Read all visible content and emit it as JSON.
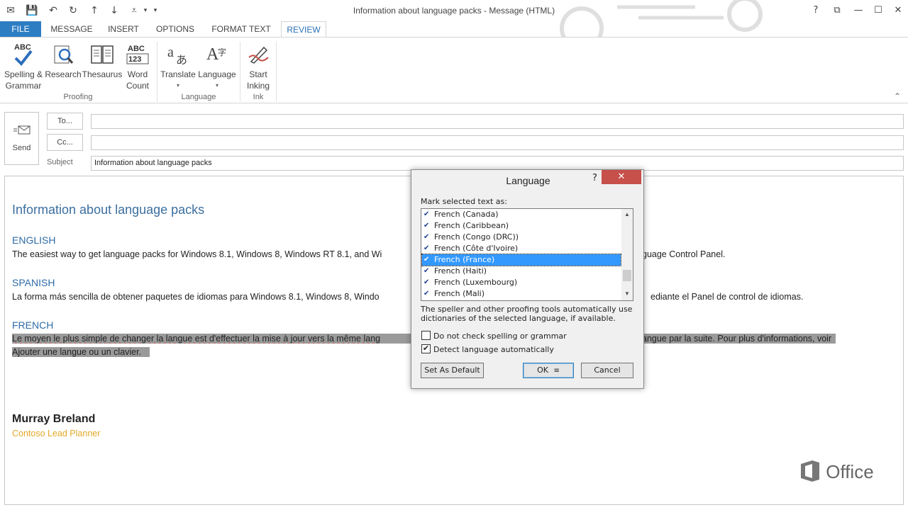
{
  "window": {
    "title": "Information about language packs - Message (HTML)",
    "help": "?",
    "restore": "⧉",
    "minimize": "—",
    "maximize": "☐",
    "close": "✕"
  },
  "qat": {
    "mail_icon": "✉",
    "save_icon": "💾",
    "undo_icon": "↶",
    "redo_icon": "↻",
    "up_icon": "↑",
    "down_icon": "↓",
    "more_icon": "▾",
    "customize_icon": "⩡"
  },
  "tabs": [
    "FILE",
    "MESSAGE",
    "INSERT",
    "OPTIONS",
    "FORMAT TEXT",
    "REVIEW"
  ],
  "ribbon": {
    "spelling_line1": "Spelling &",
    "spelling_line2": "Grammar",
    "research": "Research",
    "thesaurus": "Thesaurus",
    "word_line1": "Word",
    "word_line2": "Count",
    "translate": "Translate",
    "language": "Language",
    "start_line1": "Start",
    "start_line2": "Inking",
    "group_proofing": "Proofing",
    "group_language": "Language",
    "group_ink": "Ink",
    "abc": "ABC",
    "abc123_top": "ABC",
    "abc123_bottom": "123",
    "collapse": "⌃"
  },
  "compose": {
    "send": "Send",
    "to": "To...",
    "cc": "Cc...",
    "subject_label": "Subject",
    "to_value": "",
    "cc_value": "",
    "subject_value": "Information about language packs"
  },
  "message": {
    "title": "Information about language packs",
    "english_heading": "ENGLISH",
    "english_left": "The easiest way to get language packs for Windows 8.1, Windows 8, Windows RT 8.1, and Wi",
    "english_right": "guage Control Panel.",
    "spanish_heading": "SPANISH",
    "spanish_left": "La forma más sencilla de obtener paquetes de idiomas para Windows 8.1, Windows 8, Windo",
    "spanish_right": "ediante el Panel de control de idiomas.",
    "french_heading": "FRENCH",
    "french_left": "Le moyen le plus simple de changer la langue est d'effectuer la mise à jour vers la même lang",
    "french_right": "angue par la suite. Pour plus d'informations, voir",
    "french_line2": "Ajouter une langue ou un clavier.",
    "sig_name": "Murray Breland",
    "sig_role": "Contoso Lead Planner",
    "office": "Office"
  },
  "dialog": {
    "title": "Language",
    "help": "?",
    "close": "✕",
    "mark_label": "Mark selected text as:",
    "languages": [
      {
        "label": "French (Canada)",
        "selected": false
      },
      {
        "label": "French (Caribbean)",
        "selected": false
      },
      {
        "label": "French (Congo (DRC))",
        "selected": false
      },
      {
        "label": "French (Côte d'Ivoire)",
        "selected": false
      },
      {
        "label": "French (France)",
        "selected": true
      },
      {
        "label": "French (Haiti)",
        "selected": false
      },
      {
        "label": "French (Luxembourg)",
        "selected": false
      },
      {
        "label": "French (Mali)",
        "selected": false
      }
    ],
    "info_line1": "The speller and other proofing tools automatically use",
    "info_line2": "dictionaries of the selected language, if available.",
    "no_check_label": "Do not check spelling or grammar",
    "no_check_value": false,
    "detect_label": "Detect language automatically",
    "detect_value": true,
    "set_default": "Set As Default",
    "ok": "OK",
    "cancel": "Cancel",
    "scroll_up": "▲",
    "scroll_down": "▼",
    "checkmark": "✔"
  },
  "colors": {
    "accent": "#2d7dc3",
    "selection": "#3399ff",
    "close_red": "#c7504a",
    "signature_role": "#e2a827"
  }
}
